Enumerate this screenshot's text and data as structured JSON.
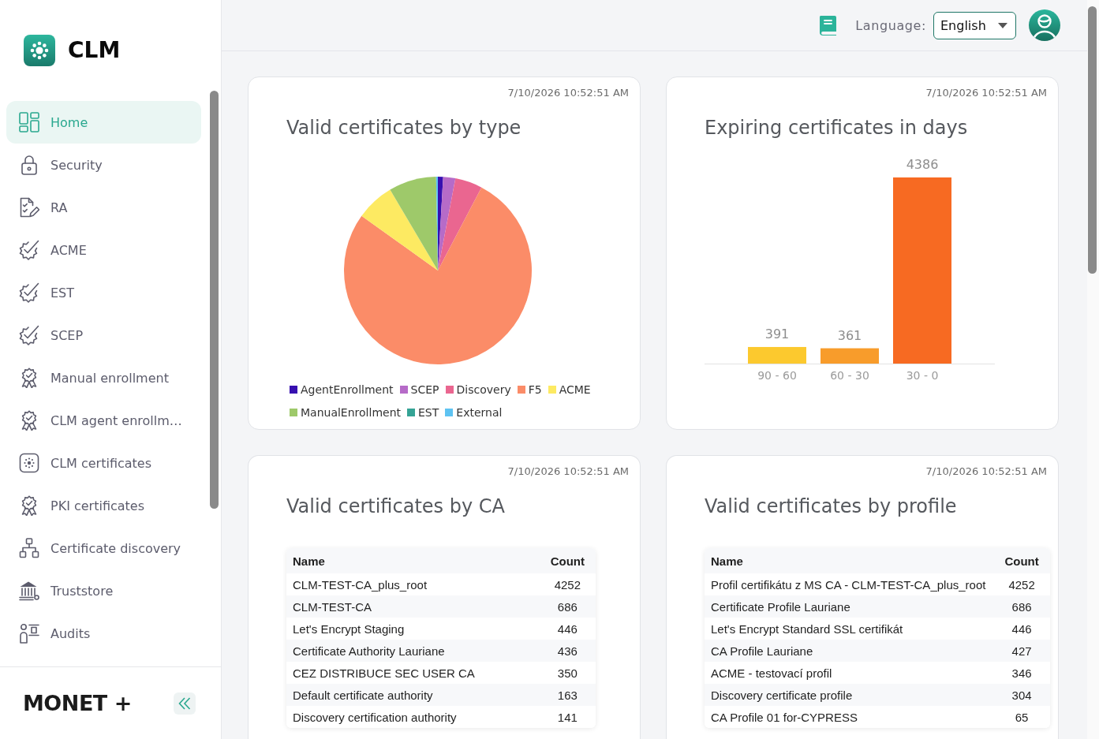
{
  "sidebar": {
    "logo_text": "CLM",
    "items": [
      {
        "label": "Home",
        "selected": true
      },
      {
        "label": "Security",
        "selected": false
      },
      {
        "label": "RA",
        "selected": false
      },
      {
        "label": "ACME",
        "selected": false
      },
      {
        "label": "EST",
        "selected": false
      },
      {
        "label": "SCEP",
        "selected": false
      },
      {
        "label": "Manual enrollment",
        "selected": false
      },
      {
        "label": "CLM agent enrollm…",
        "selected": false
      },
      {
        "label": "CLM certificates",
        "selected": false
      },
      {
        "label": "PKI certificates",
        "selected": false
      },
      {
        "label": "Certificate discovery",
        "selected": false
      },
      {
        "label": "Truststore",
        "selected": false
      },
      {
        "label": "Audits",
        "selected": false
      }
    ],
    "footer_brand": "MONET +"
  },
  "header": {
    "language_label": "Language:",
    "language_value": "English"
  },
  "cards": [
    {
      "kind": "chart",
      "timestamp": "7/10/2026 10:52:51 AM",
      "title": "Valid certificates by type",
      "chart_data": {
        "type": "pie",
        "categories": [
          "AgentEnrollment",
          "SCEP",
          "Discovery",
          "F5",
          "ACME",
          "ManualEnrollment",
          "EST",
          "External"
        ],
        "values": [
          0.9,
          2.1,
          4.7,
          77.2,
          6.6,
          8.2,
          0,
          0.3
        ],
        "colors": [
          "#3710b0",
          "#b66bc8",
          "#ea6690",
          "#fb8c68",
          "#fdea62",
          "#9ec96a",
          "#35a395",
          "#5ec3f2"
        ],
        "legend": "bottom"
      }
    },
    {
      "kind": "chart",
      "timestamp": "7/10/2026 10:52:51 AM",
      "title": "Expiring certificates in days",
      "chart_data": {
        "type": "bar",
        "categories": [
          "90 - 60",
          "60 - 30",
          "30 - 0"
        ],
        "values": [
          391,
          361,
          4386
        ],
        "colors": [
          "#fcc92e",
          "#f89c2b",
          "#f76a22"
        ],
        "data_labels": true
      }
    },
    {
      "kind": "table",
      "timestamp": "7/10/2026 10:52:51 AM",
      "title": "Valid certificates by CA",
      "table": {
        "columns": [
          "Name",
          "Count"
        ],
        "rows": [
          [
            "CLM-TEST-CA_plus_root",
            "4252"
          ],
          [
            "CLM-TEST-CA",
            "686"
          ],
          [
            "Let's Encrypt Staging",
            "446"
          ],
          [
            "Certificate Authority Lauriane",
            "436"
          ],
          [
            "CEZ DISTRIBUCE SEC USER CA",
            "350"
          ],
          [
            "Default certificate authority",
            "163"
          ],
          [
            "Discovery certification authority",
            "141"
          ]
        ]
      }
    },
    {
      "kind": "table",
      "timestamp": "7/10/2026 10:52:51 AM",
      "title": "Valid certificates by profile",
      "table": {
        "columns": [
          "Name",
          "Count"
        ],
        "rows": [
          [
            "Profil certifikátu z MS CA - CLM-TEST-CA_plus_root",
            "4252"
          ],
          [
            "Certificate Profile Lauriane",
            "686"
          ],
          [
            "Let's Encrypt Standard SSL certifikát",
            "446"
          ],
          [
            "CA Profile Lauriane",
            "427"
          ],
          [
            "ACME - testovací profil",
            "346"
          ],
          [
            "Discovery certificate profile",
            "304"
          ],
          [
            "CA Profile 01 for-CYPRESS",
            "65"
          ]
        ]
      }
    }
  ]
}
